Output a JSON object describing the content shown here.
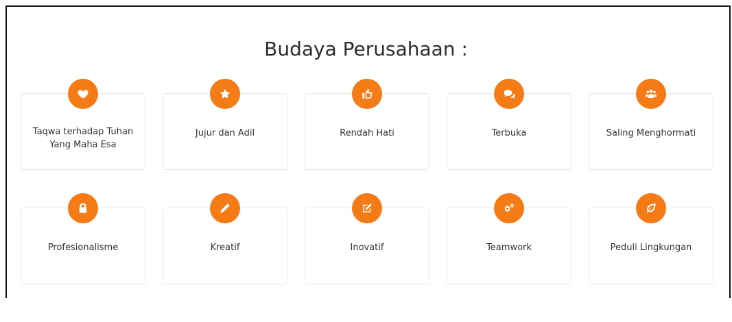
{
  "section": {
    "title": "Budaya Perusahaan :"
  },
  "values": [
    {
      "label": "Taqwa terhadap Tuhan Yang Maha Esa",
      "icon": "heart-icon"
    },
    {
      "label": "Jujur dan Adil",
      "icon": "star-icon"
    },
    {
      "label": "Rendah Hati",
      "icon": "thumbs-up-icon"
    },
    {
      "label": "Terbuka",
      "icon": "comments-icon"
    },
    {
      "label": "Saling Menghormati",
      "icon": "users-icon"
    },
    {
      "label": "Profesionalisme",
      "icon": "lock-icon"
    },
    {
      "label": "Kreatif",
      "icon": "pencil-icon"
    },
    {
      "label": "Inovatif",
      "icon": "edit-icon"
    },
    {
      "label": "Teamwork",
      "icon": "gears-icon"
    },
    {
      "label": "Peduli Lingkungan",
      "icon": "leaf-icon"
    }
  ],
  "colors": {
    "accent": "#f47b16",
    "card_border": "#e8e8e8",
    "text": "#333333"
  }
}
